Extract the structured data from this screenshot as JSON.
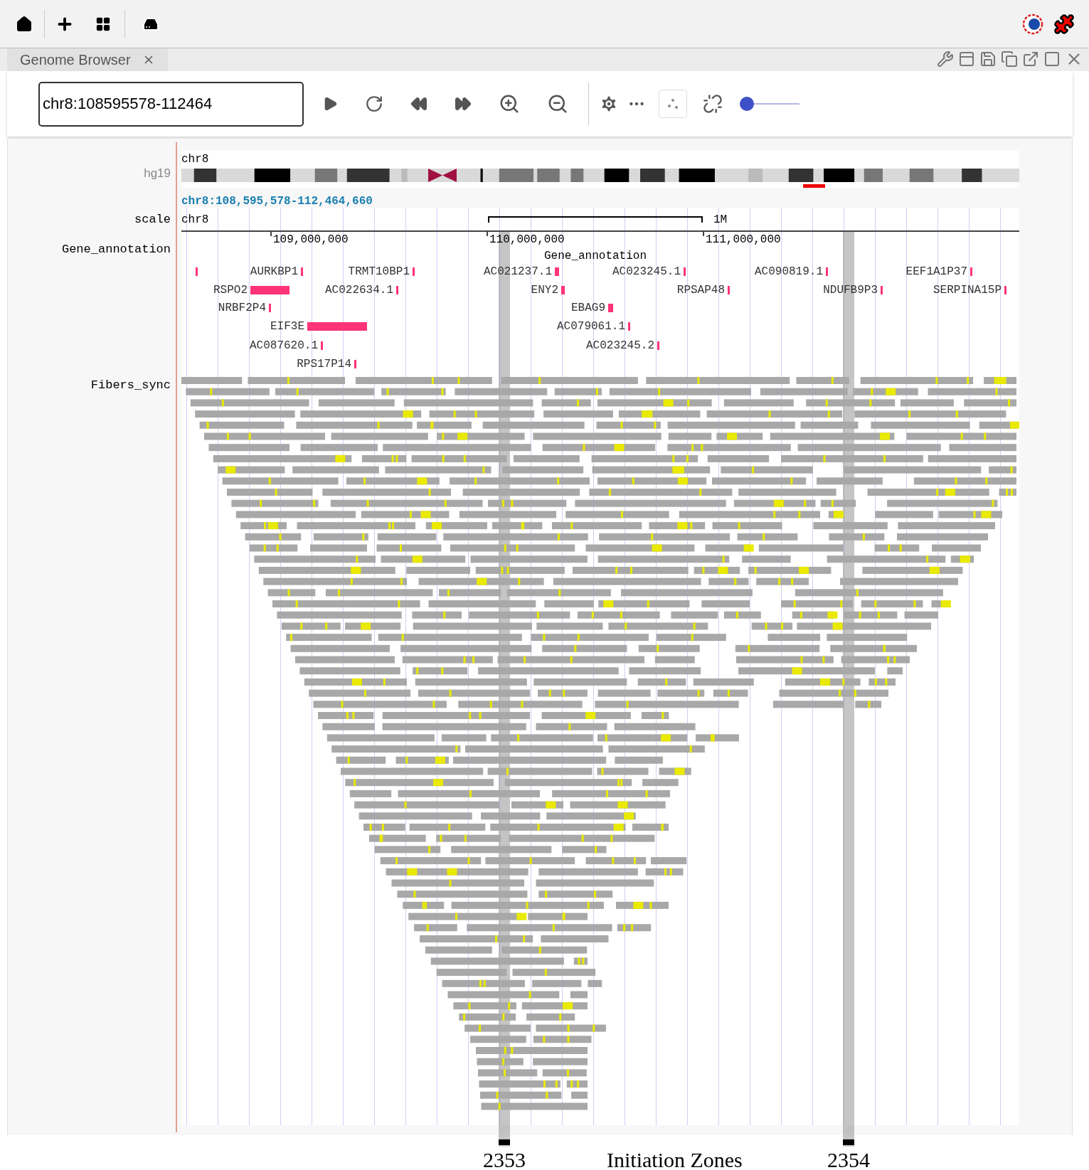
{
  "tabs": [
    {
      "label": "Genome Browser",
      "selected": true
    }
  ],
  "locus_field": {
    "value": "chr8:108595578-112464"
  },
  "zoom_slider": {
    "level": 0
  },
  "tracks": {
    "hg19": {
      "label": "hg19",
      "chromosome": "chr8",
      "region": "chr8:108,595,578-112,464,660"
    },
    "scale": {
      "label": "scale",
      "chromosome": "chr8",
      "bar_label": "1M",
      "ticks": [
        "109,000,000",
        "110,000,000",
        "111,000,000"
      ]
    },
    "gene_annotation": {
      "label": "Gene_annotation",
      "title": "Gene_annotation",
      "genes": [
        {
          "label": "AURKBP1"
        },
        {
          "label": "TRMT10BP1"
        },
        {
          "label": "AC021237.1"
        },
        {
          "label": "AC023245.1"
        },
        {
          "label": "AC090819.1"
        },
        {
          "label": "EEF1A1P37"
        },
        {
          "label": "RSPO2"
        },
        {
          "label": "AC022634.1"
        },
        {
          "label": "ENY2"
        },
        {
          "label": "RPSAP48"
        },
        {
          "label": "NDUFB9P3"
        },
        {
          "label": "SERPINA15P"
        },
        {
          "label": "NRBF2P4"
        },
        {
          "label": "EBAG9"
        },
        {
          "label": "EIF3E"
        },
        {
          "label": "AC079061.1"
        },
        {
          "label": "AC087620.1"
        },
        {
          "label": "AC023245.2"
        },
        {
          "label": "RPS17P14"
        }
      ]
    },
    "fibers": {
      "label": "Fibers_sync"
    }
  },
  "initiation_zones": {
    "caption": "Initiation Zones",
    "zones": [
      {
        "label": "2353"
      },
      {
        "label": "2354"
      }
    ]
  }
}
